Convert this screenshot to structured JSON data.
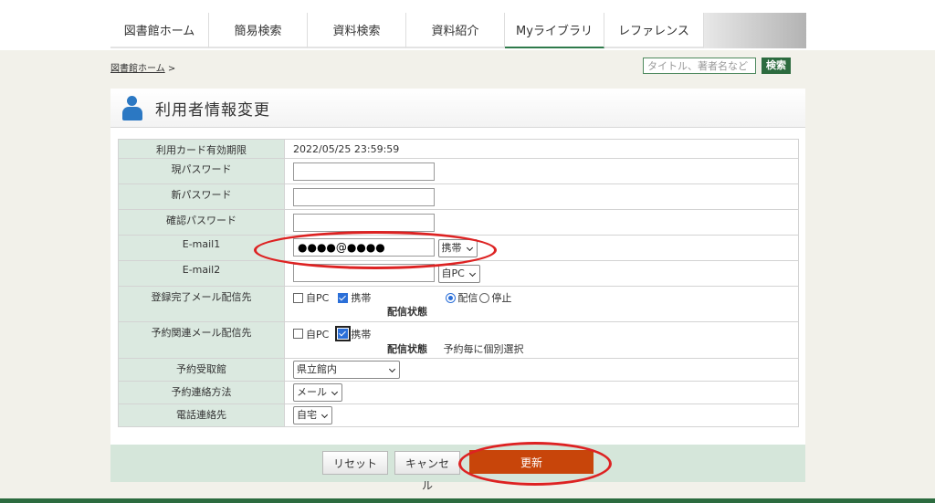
{
  "nav": {
    "items": [
      {
        "label": "図書館ホーム"
      },
      {
        "label": "簡易検索"
      },
      {
        "label": "資料検索"
      },
      {
        "label": "資料紹介"
      },
      {
        "label": "Myライブラリ"
      },
      {
        "label": "レファレンス"
      }
    ],
    "active": "Myライブラリ"
  },
  "breadcrumb": {
    "home": "図書館ホーム",
    "separator": ">"
  },
  "search": {
    "placeholder": "タイトル、著者名など",
    "button": "検索"
  },
  "page": {
    "title": "利用者情報変更"
  },
  "form": {
    "card_expiry": {
      "label": "利用カード有効期限",
      "value": "2022/05/25 23:59:59"
    },
    "current_password": {
      "label": "現パスワード",
      "value": ""
    },
    "new_password": {
      "label": "新パスワード",
      "value": ""
    },
    "confirm_password": {
      "label": "確認パスワード",
      "value": ""
    },
    "email1": {
      "label": "E-mail1",
      "value": "●●●●@●●●●",
      "type": "携帯"
    },
    "email2": {
      "label": "E-mail2",
      "value": "",
      "type": "自PC"
    },
    "registration_mail": {
      "label": "登録完了メール配信先",
      "opt_pc": "自PC",
      "opt_pc_checked": false,
      "opt_mobile": "携帯",
      "opt_mobile_checked": true,
      "status_label": "配信状態",
      "radio_on": "配信",
      "radio_off": "停止",
      "selected": "配信"
    },
    "reservation_mail": {
      "label": "予約関連メール配信先",
      "opt_pc": "自PC",
      "opt_pc_checked": false,
      "opt_mobile": "携帯",
      "opt_mobile_checked": true,
      "status_label": "配信状態",
      "status_value": "予約毎に個別選択"
    },
    "pickup_library": {
      "label": "予約受取館",
      "value": "県立館内"
    },
    "contact_method": {
      "label": "予約連絡方法",
      "value": "メール"
    },
    "phone_contact": {
      "label": "電話連絡先",
      "value": "自宅"
    }
  },
  "buttons": {
    "reset": "リセット",
    "cancel": "キャンセル",
    "update": "更新"
  },
  "colors": {
    "brand_green": "#2c6b3f",
    "label_bg": "#dbe9e0",
    "update_button": "#c8450a",
    "annotation_red": "#dd2222",
    "user_icon": "#2b78c3"
  }
}
